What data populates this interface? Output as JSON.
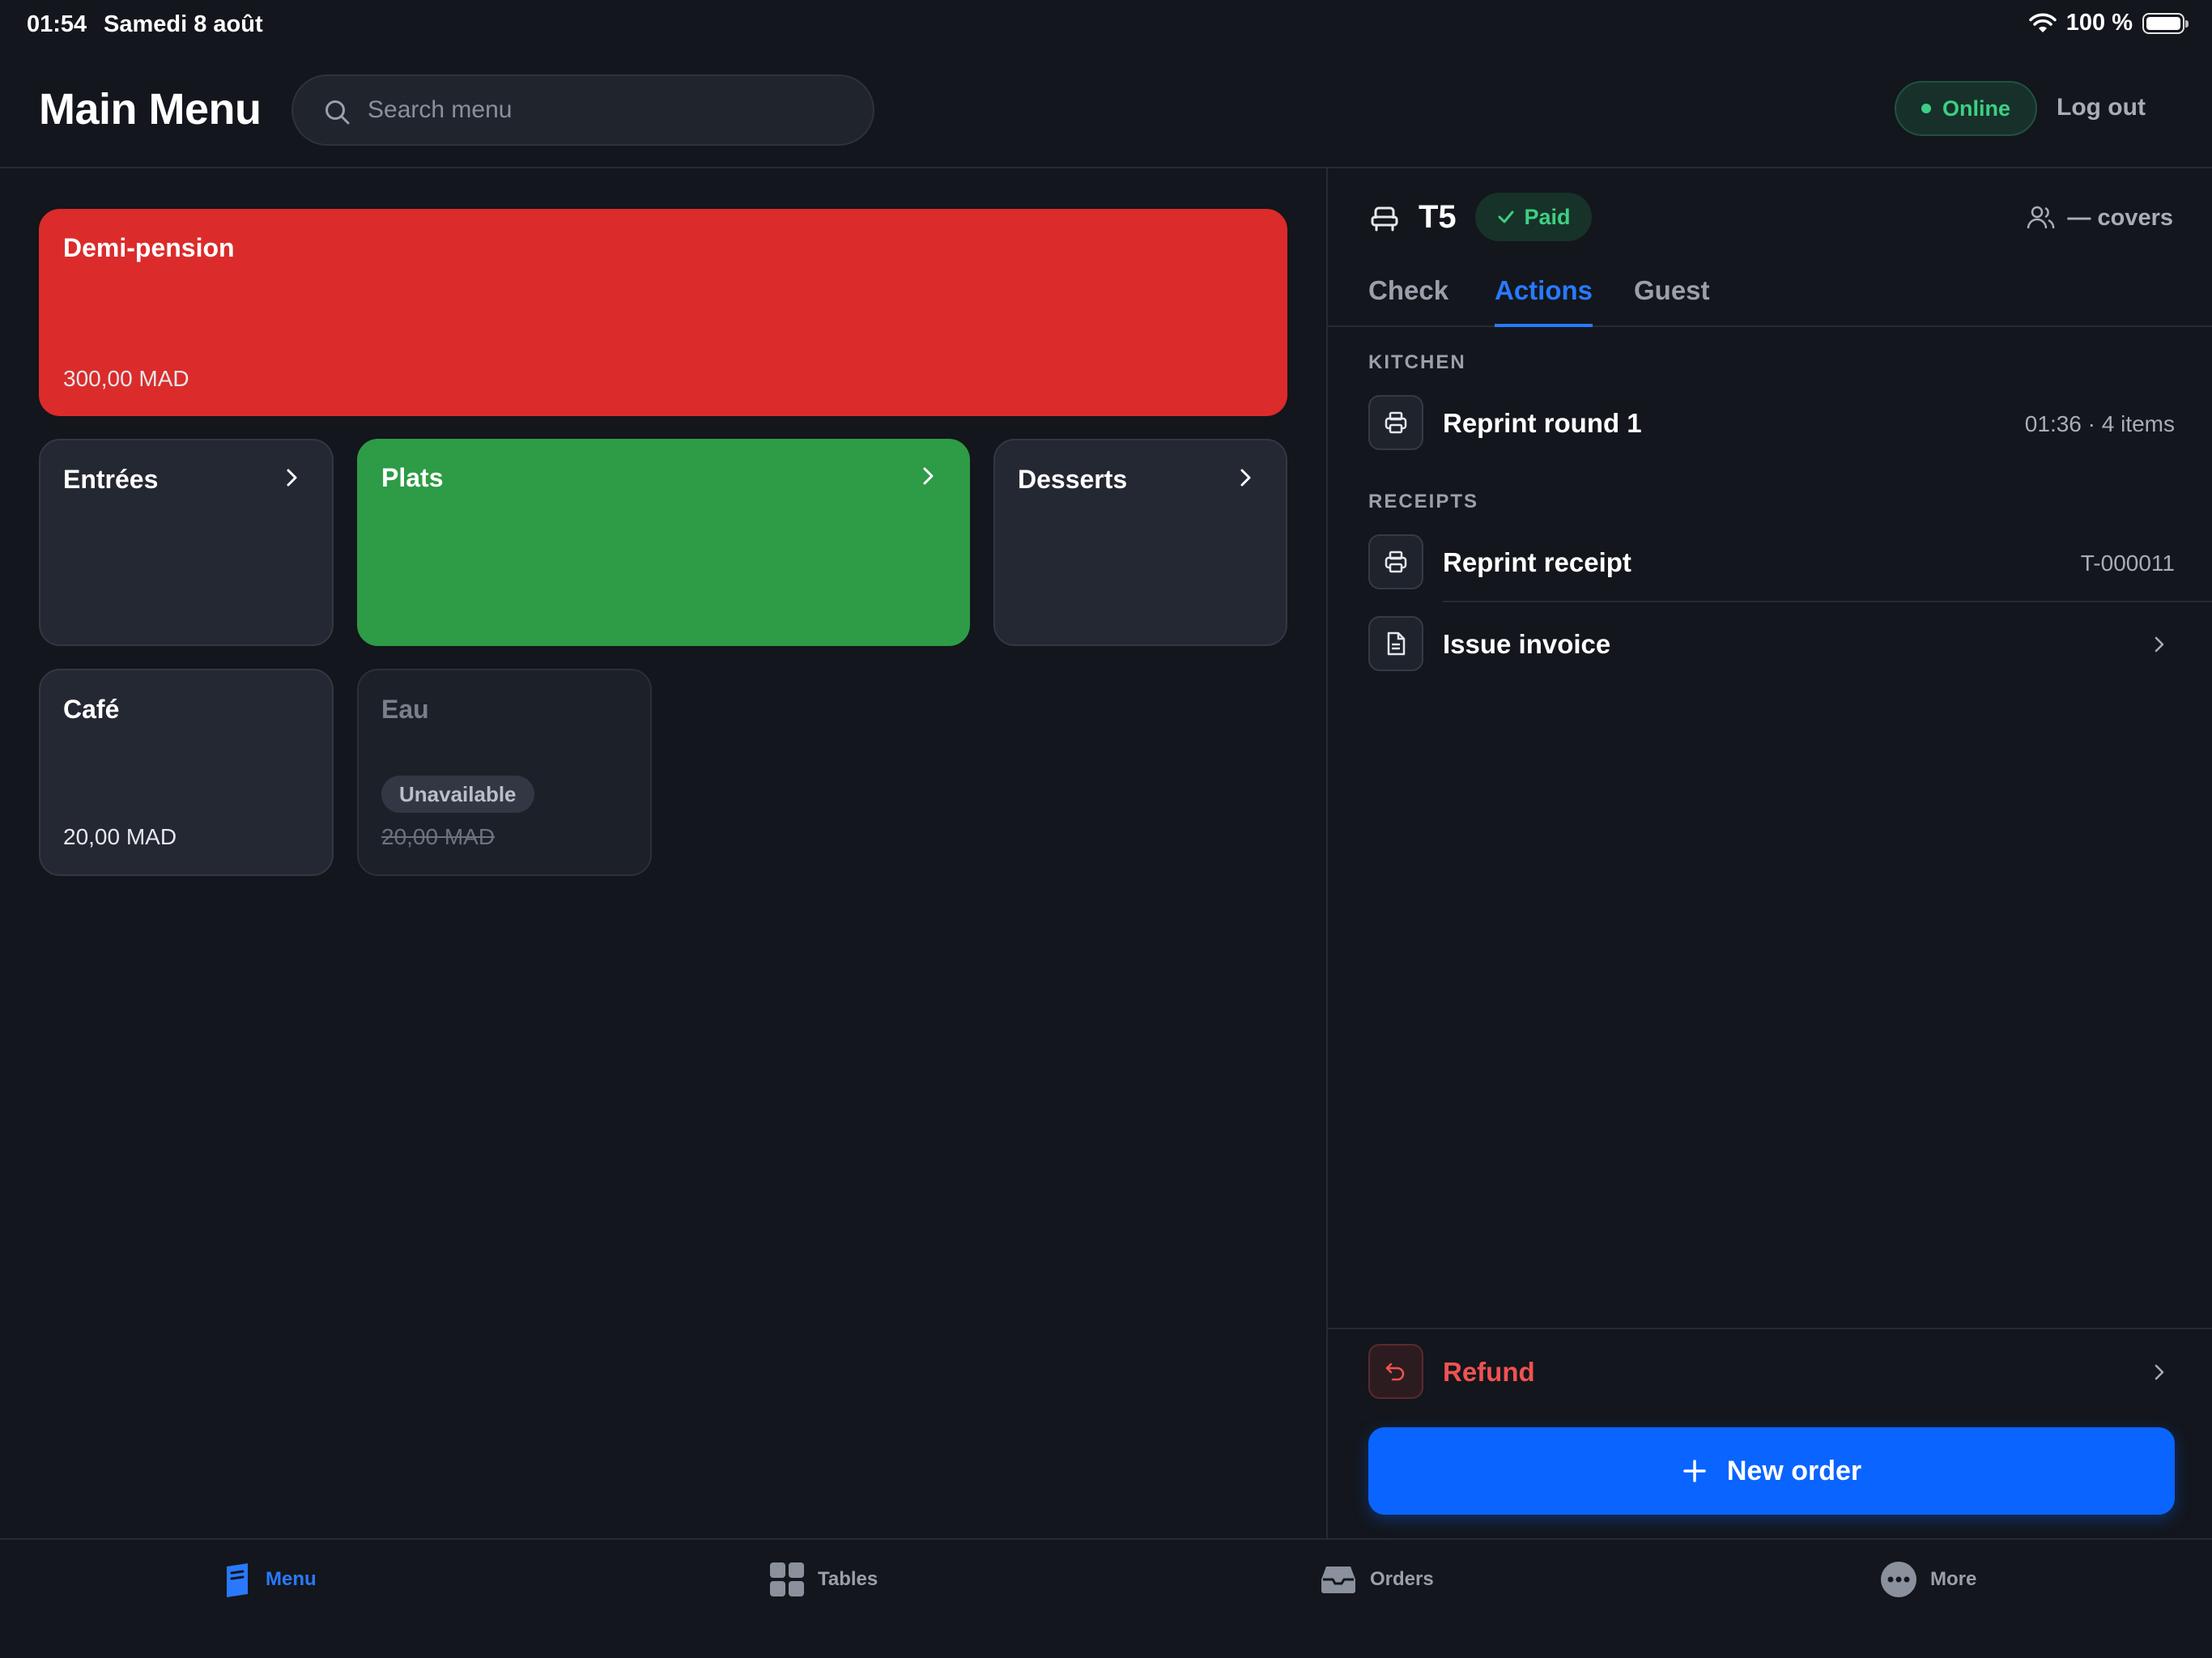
{
  "status_bar": {
    "time": "01:54",
    "date": "Samedi 8 août",
    "battery": "100 %"
  },
  "header": {
    "title": "Main Menu",
    "search_placeholder": "Search menu",
    "status": "Online",
    "logout": "Log out"
  },
  "menu": {
    "featured": {
      "name": "Demi-pension",
      "price": "300,00 MAD"
    },
    "categories": [
      {
        "name": "Entrées"
      },
      {
        "name": "Plats"
      },
      {
        "name": "Desserts"
      }
    ],
    "items": [
      {
        "name": "Café",
        "price": "20,00 MAD"
      },
      {
        "name": "Eau",
        "badge": "Unavailable",
        "price": "20,00 MAD"
      }
    ]
  },
  "panel": {
    "table": "T5",
    "paid": "Paid",
    "covers": "— covers",
    "tabs": [
      "Check",
      "Actions",
      "Guest"
    ],
    "active_tab": "Actions",
    "kitchen_label": "KITCHEN",
    "reprint_round": {
      "label": "Reprint round 1",
      "meta": "01:36 · 4 items"
    },
    "receipts_label": "RECEIPTS",
    "reprint_receipt": {
      "label": "Reprint receipt",
      "meta": "T-000011"
    },
    "issue_invoice": {
      "label": "Issue invoice"
    },
    "refund": {
      "label": "Refund"
    },
    "new_order": "New order"
  },
  "bottom_nav": {
    "items": [
      {
        "label": "Menu",
        "icon": "menu-book-icon"
      },
      {
        "label": "Tables",
        "icon": "grid-icon"
      },
      {
        "label": "Orders",
        "icon": "inbox-icon"
      },
      {
        "label": "More",
        "icon": "more-icon"
      }
    ],
    "active": "Menu"
  },
  "colors": {
    "accent": "#2979ff",
    "featured": "#dc2b2b",
    "plats": "#2e9b46",
    "online": "#3ecf84",
    "refund": "#f05252"
  }
}
